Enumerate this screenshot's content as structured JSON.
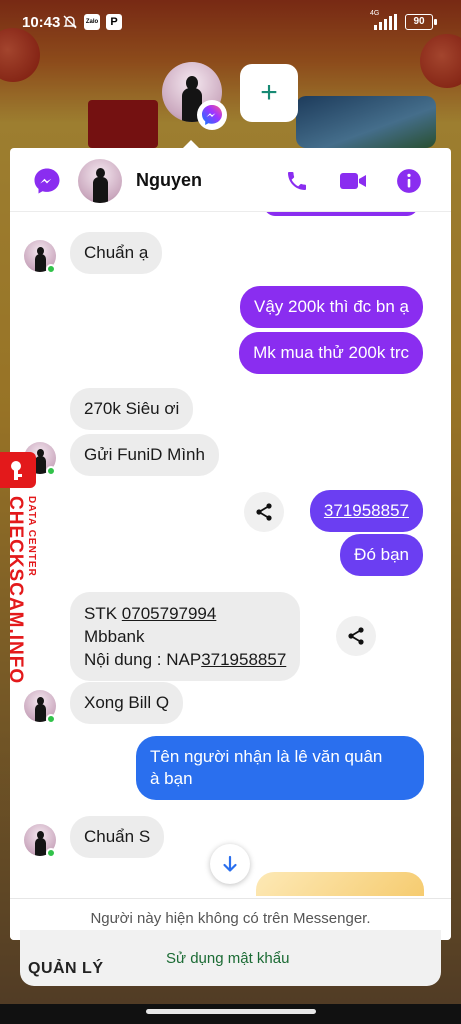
{
  "status_bar": {
    "time": "10:43",
    "app_badge_zalo": "Zalo",
    "network": "4G",
    "battery": "90"
  },
  "chat": {
    "contact_name": "Nguyen",
    "footer_notice": "Người này hiện không có trên Messenger.",
    "messages": [
      {
        "text": "Chuẩn ạ"
      },
      {
        "text": "Vậy 200k thì đc bn ạ"
      },
      {
        "text": "Mk mua thử 200k trc"
      },
      {
        "text": "270k Siêu ơi"
      },
      {
        "text": "Gửi FuniD Mình"
      },
      {
        "text": "371958857"
      },
      {
        "text": "Đó bạn"
      },
      {
        "line1_prefix": "STK ",
        "line1_value": "0705797994",
        "line2": "Mbbank",
        "line3_prefix": "Nội dung : NAP",
        "line3_value": "371958857"
      },
      {
        "text": "Xong Bill Q"
      },
      {
        "line1": "Tên người nhận là lê văn quân",
        "line2": "à bạn"
      },
      {
        "text": "Chuẩn S"
      }
    ]
  },
  "background_sheet": {
    "manage_label": "QUẢN LÝ",
    "password_label": "Sử dụng mật khẩu"
  },
  "watermark": {
    "brand": "CHECKSCAM.INFO",
    "sub": "DATA CENTER"
  },
  "colors": {
    "messenger_purple": "#8a2df0",
    "outgoing_violet": "#6b3ef2",
    "outgoing_blue": "#2a6fee",
    "incoming_gray": "#ececec"
  },
  "icons": [
    "messenger-icon",
    "phone-icon",
    "video-icon",
    "info-icon",
    "share-icon",
    "arrow-down-icon",
    "plus-icon"
  ]
}
